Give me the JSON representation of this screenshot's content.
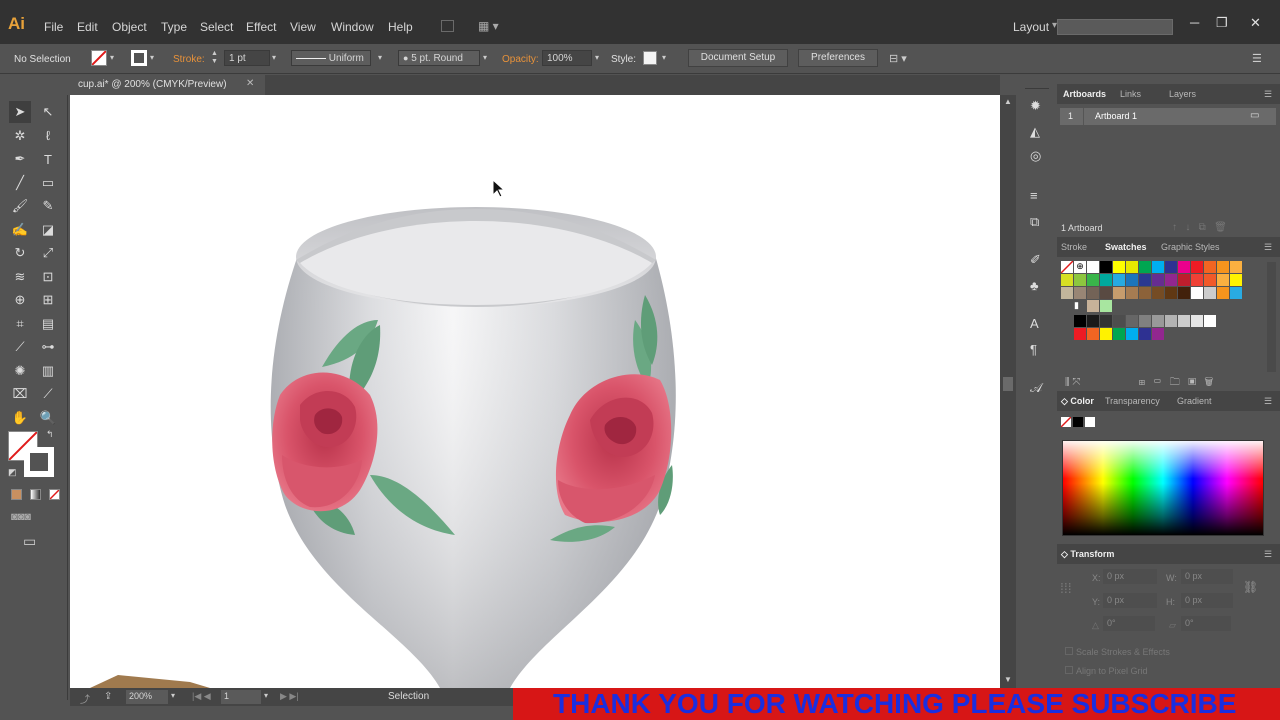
{
  "app": {
    "logo": "Ai"
  },
  "menu": [
    "File",
    "Edit",
    "Object",
    "Type",
    "Select",
    "Effect",
    "View",
    "Window",
    "Help"
  ],
  "workspace": {
    "label": "Layout"
  },
  "control": {
    "selection": "No Selection",
    "stroke_label": "Stroke:",
    "stroke_weight": "1 pt",
    "profile": "Uniform",
    "brush": "5 pt. Round",
    "opacity_label": "Opacity:",
    "opacity": "100%",
    "style_label": "Style:",
    "doc_setup": "Document Setup",
    "preferences": "Preferences"
  },
  "document": {
    "tab": "cup.ai* @ 200% (CMYK/Preview)"
  },
  "status": {
    "zoom": "200%",
    "artboard": "1",
    "tool": "Selection"
  },
  "artboards_panel": {
    "tabs": [
      "Artboards",
      "Links",
      "Layers"
    ],
    "row_num": "1",
    "row_name": "Artboard 1",
    "footer": "1 Artboard"
  },
  "swatches_panel": {
    "tabs": [
      "Stroke",
      "Swatches",
      "Graphic Styles"
    ]
  },
  "color_panel": {
    "tabs": [
      "Color",
      "Transparency",
      "Gradient"
    ]
  },
  "transform_panel": {
    "title": "Transform",
    "x_label": "X:",
    "x": "0 px",
    "y_label": "Y:",
    "y": "0 px",
    "w_label": "W:",
    "w": "0 px",
    "h_label": "H:",
    "h": "0 px",
    "angle": "0°",
    "shear": "0°",
    "scale_strokes": "Scale Strokes & Effects",
    "align_pixel": "Align to Pixel Grid"
  },
  "banner": {
    "text": "THANK YOU FOR WATCHING PLEASE SUBSCRIBE"
  },
  "colors": {
    "accent": "#e8923a",
    "banner_bg": "#d71616",
    "banner_text": "#1a2ee0"
  }
}
